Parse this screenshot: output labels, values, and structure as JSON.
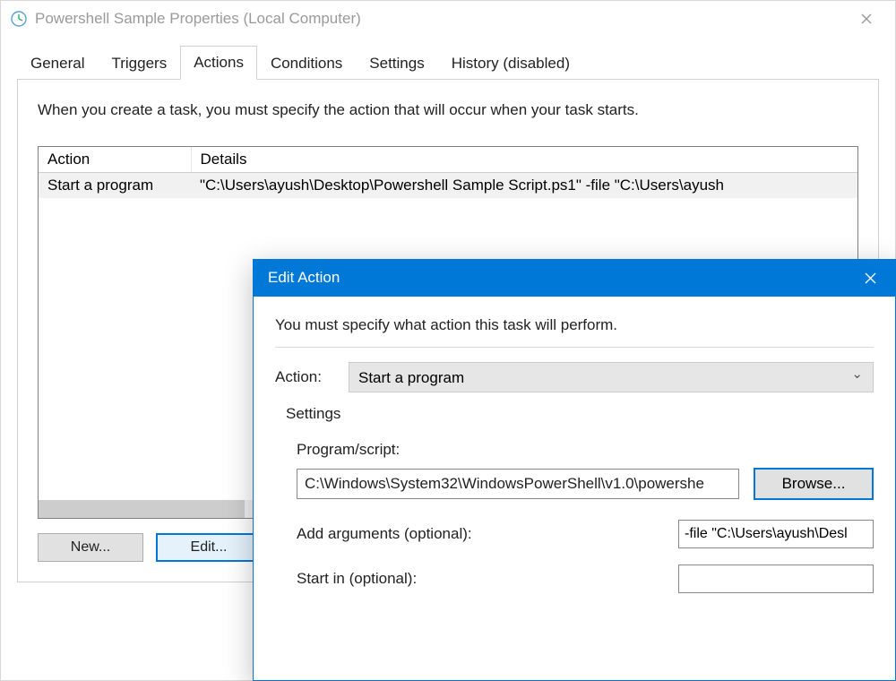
{
  "main_window": {
    "title": "Powershell Sample Properties (Local Computer)",
    "tabs": [
      {
        "label": "General"
      },
      {
        "label": "Triggers"
      },
      {
        "label": "Actions"
      },
      {
        "label": "Conditions"
      },
      {
        "label": "Settings"
      },
      {
        "label": "History (disabled)"
      }
    ],
    "active_tab_index": 2,
    "panel": {
      "intro": "When you create a task, you must specify the action that will occur when your task starts.",
      "columns": {
        "action": "Action",
        "details": "Details"
      },
      "rows": [
        {
          "action": "Start a program",
          "details": "\"C:\\Users\\ayush\\Desktop\\Powershell Sample Script.ps1\" -file \"C:\\Users\\ayush"
        }
      ],
      "buttons": {
        "new": "New...",
        "edit": "Edit..."
      }
    }
  },
  "dialog": {
    "title": "Edit Action",
    "instruction": "You must specify what action this task will perform.",
    "action_label": "Action:",
    "action_value": "Start a program",
    "settings_label": "Settings",
    "program_label": "Program/script:",
    "program_value": "C:\\Windows\\System32\\WindowsPowerShell\\v1.0\\powershe",
    "browse_label": "Browse...",
    "args_label": "Add arguments (optional):",
    "args_value": "-file \"C:\\Users\\ayush\\Desl",
    "startin_label": "Start in (optional):",
    "startin_value": ""
  }
}
